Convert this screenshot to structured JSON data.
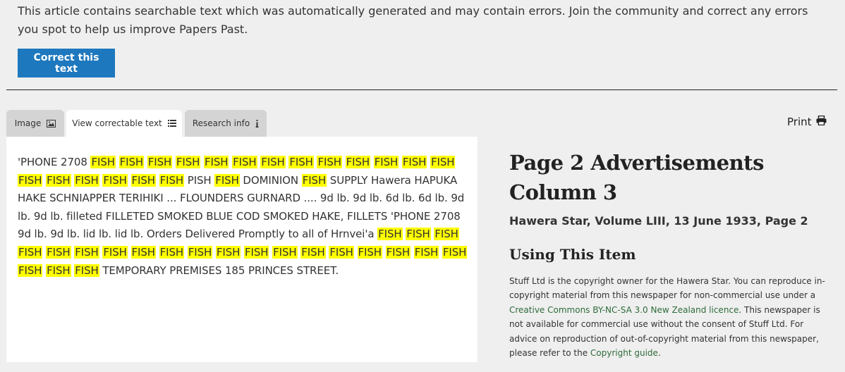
{
  "notice": {
    "text": "This article contains searchable text which was automatically generated and may contain errors. Join the community and correct any errors you spot to help us improve Papers Past.",
    "button_label": "Correct this text"
  },
  "tabs": [
    {
      "label": "Image",
      "icon": "image-icon",
      "active": false
    },
    {
      "label": "View correctable text",
      "icon": "list-icon",
      "active": true
    },
    {
      "label": "Research info",
      "icon": "info-icon",
      "active": false
    }
  ],
  "print": {
    "label": "Print",
    "icon": "printer-icon"
  },
  "article": {
    "highlight_color": "#ffff00",
    "segments": [
      {
        "t": "'PHONE 2708 ",
        "h": false
      },
      {
        "t": "FISH",
        "h": true
      },
      {
        "t": " ",
        "h": false
      },
      {
        "t": "FISH",
        "h": true
      },
      {
        "t": " ",
        "h": false
      },
      {
        "t": "FISH",
        "h": true
      },
      {
        "t": " ",
        "h": false
      },
      {
        "t": "FISH",
        "h": true
      },
      {
        "t": " ",
        "h": false
      },
      {
        "t": "FISH",
        "h": true
      },
      {
        "t": " ",
        "h": false
      },
      {
        "t": "FISH",
        "h": true
      },
      {
        "t": " ",
        "h": false
      },
      {
        "t": "FISH",
        "h": true
      },
      {
        "t": " ",
        "h": false
      },
      {
        "t": "FISH",
        "h": true
      },
      {
        "t": " ",
        "h": false
      },
      {
        "t": "FISH",
        "h": true
      },
      {
        "t": " ",
        "h": false
      },
      {
        "t": "FISH",
        "h": true
      },
      {
        "t": " ",
        "h": false
      },
      {
        "t": "FISH",
        "h": true
      },
      {
        "t": " ",
        "h": false
      },
      {
        "t": "FISH",
        "h": true
      },
      {
        "t": " ",
        "h": false
      },
      {
        "t": "FISH",
        "h": true
      },
      {
        "t": " ",
        "h": false
      },
      {
        "t": "FISH",
        "h": true
      },
      {
        "t": " ",
        "h": false
      },
      {
        "t": "FISH",
        "h": true
      },
      {
        "t": " ",
        "h": false
      },
      {
        "t": "FISH",
        "h": true
      },
      {
        "t": " ",
        "h": false
      },
      {
        "t": "FISH",
        "h": true
      },
      {
        "t": " ",
        "h": false
      },
      {
        "t": "FISH",
        "h": true
      },
      {
        "t": " ",
        "h": false
      },
      {
        "t": "FISH",
        "h": true
      },
      {
        "t": " PISH ",
        "h": false
      },
      {
        "t": "FISH",
        "h": true
      },
      {
        "t": " DOMINION ",
        "h": false
      },
      {
        "t": "FISH",
        "h": true
      },
      {
        "t": " SUPPLY Hawera HAPUKA HAKE SCHNIAPPER TERIHIKI ... FLOUNDERS GURNARD .... 9d lb. 9d lb. 6d lb. 6d lb. 9d lb. 9d lb. filleted FILLETED SMOKED BLUE COD SMOKED HAKE, FILLETS 'PHONE 2708 9d lb. 9d lb. lid lb. lid lb. Orders Delivered Promptly to all of Hrnvei'a ",
        "h": false
      },
      {
        "t": "FISH",
        "h": true
      },
      {
        "t": " ",
        "h": false
      },
      {
        "t": "FISH",
        "h": true
      },
      {
        "t": " ",
        "h": false
      },
      {
        "t": "FISH",
        "h": true
      },
      {
        "t": " ",
        "h": false
      },
      {
        "t": "FISH",
        "h": true
      },
      {
        "t": " ",
        "h": false
      },
      {
        "t": "FISH",
        "h": true
      },
      {
        "t": " ",
        "h": false
      },
      {
        "t": "FISH",
        "h": true
      },
      {
        "t": " ",
        "h": false
      },
      {
        "t": "FISH",
        "h": true
      },
      {
        "t": " ",
        "h": false
      },
      {
        "t": "FISH",
        "h": true
      },
      {
        "t": " ",
        "h": false
      },
      {
        "t": "FISH",
        "h": true
      },
      {
        "t": " ",
        "h": false
      },
      {
        "t": "FISH",
        "h": true
      },
      {
        "t": " ",
        "h": false
      },
      {
        "t": "FISH",
        "h": true
      },
      {
        "t": " ",
        "h": false
      },
      {
        "t": "FISH",
        "h": true
      },
      {
        "t": " ",
        "h": false
      },
      {
        "t": "FISH",
        "h": true
      },
      {
        "t": " ",
        "h": false
      },
      {
        "t": "FISH",
        "h": true
      },
      {
        "t": " ",
        "h": false
      },
      {
        "t": "FISH",
        "h": true
      },
      {
        "t": " ",
        "h": false
      },
      {
        "t": "FISH",
        "h": true
      },
      {
        "t": " ",
        "h": false
      },
      {
        "t": "FISH",
        "h": true
      },
      {
        "t": " ",
        "h": false
      },
      {
        "t": "FISH",
        "h": true
      },
      {
        "t": " ",
        "h": false
      },
      {
        "t": "FISH",
        "h": true
      },
      {
        "t": " ",
        "h": false
      },
      {
        "t": "FISH",
        "h": true
      },
      {
        "t": " ",
        "h": false
      },
      {
        "t": "FISH",
        "h": true
      },
      {
        "t": " ",
        "h": false
      },
      {
        "t": "FISH",
        "h": true
      },
      {
        "t": " TEMPORARY PREMISES 185 PRINCES STREET.",
        "h": false
      }
    ]
  },
  "sidebar": {
    "title": "Page 2 Advertisements Column 3",
    "publication": "Hawera Star, Volume LIII, 13 June 1933, Page 2",
    "using_title": "Using This Item",
    "rights_part1": "Stuff Ltd is the copyright owner for the Hawera Star. You can reproduce in-copyright material from this newspaper for non-commercial use under a ",
    "licence_link": "Creative Commons BY-NC-SA 3.0 New Zealand licence",
    "rights_part2": ". This newspaper is not available for commercial use without the consent of Stuff Ltd. For advice on reproduction of out-of-copyright material from this newspaper, please refer to the ",
    "copyright_link": "Copyright guide",
    "rights_part3": "."
  }
}
